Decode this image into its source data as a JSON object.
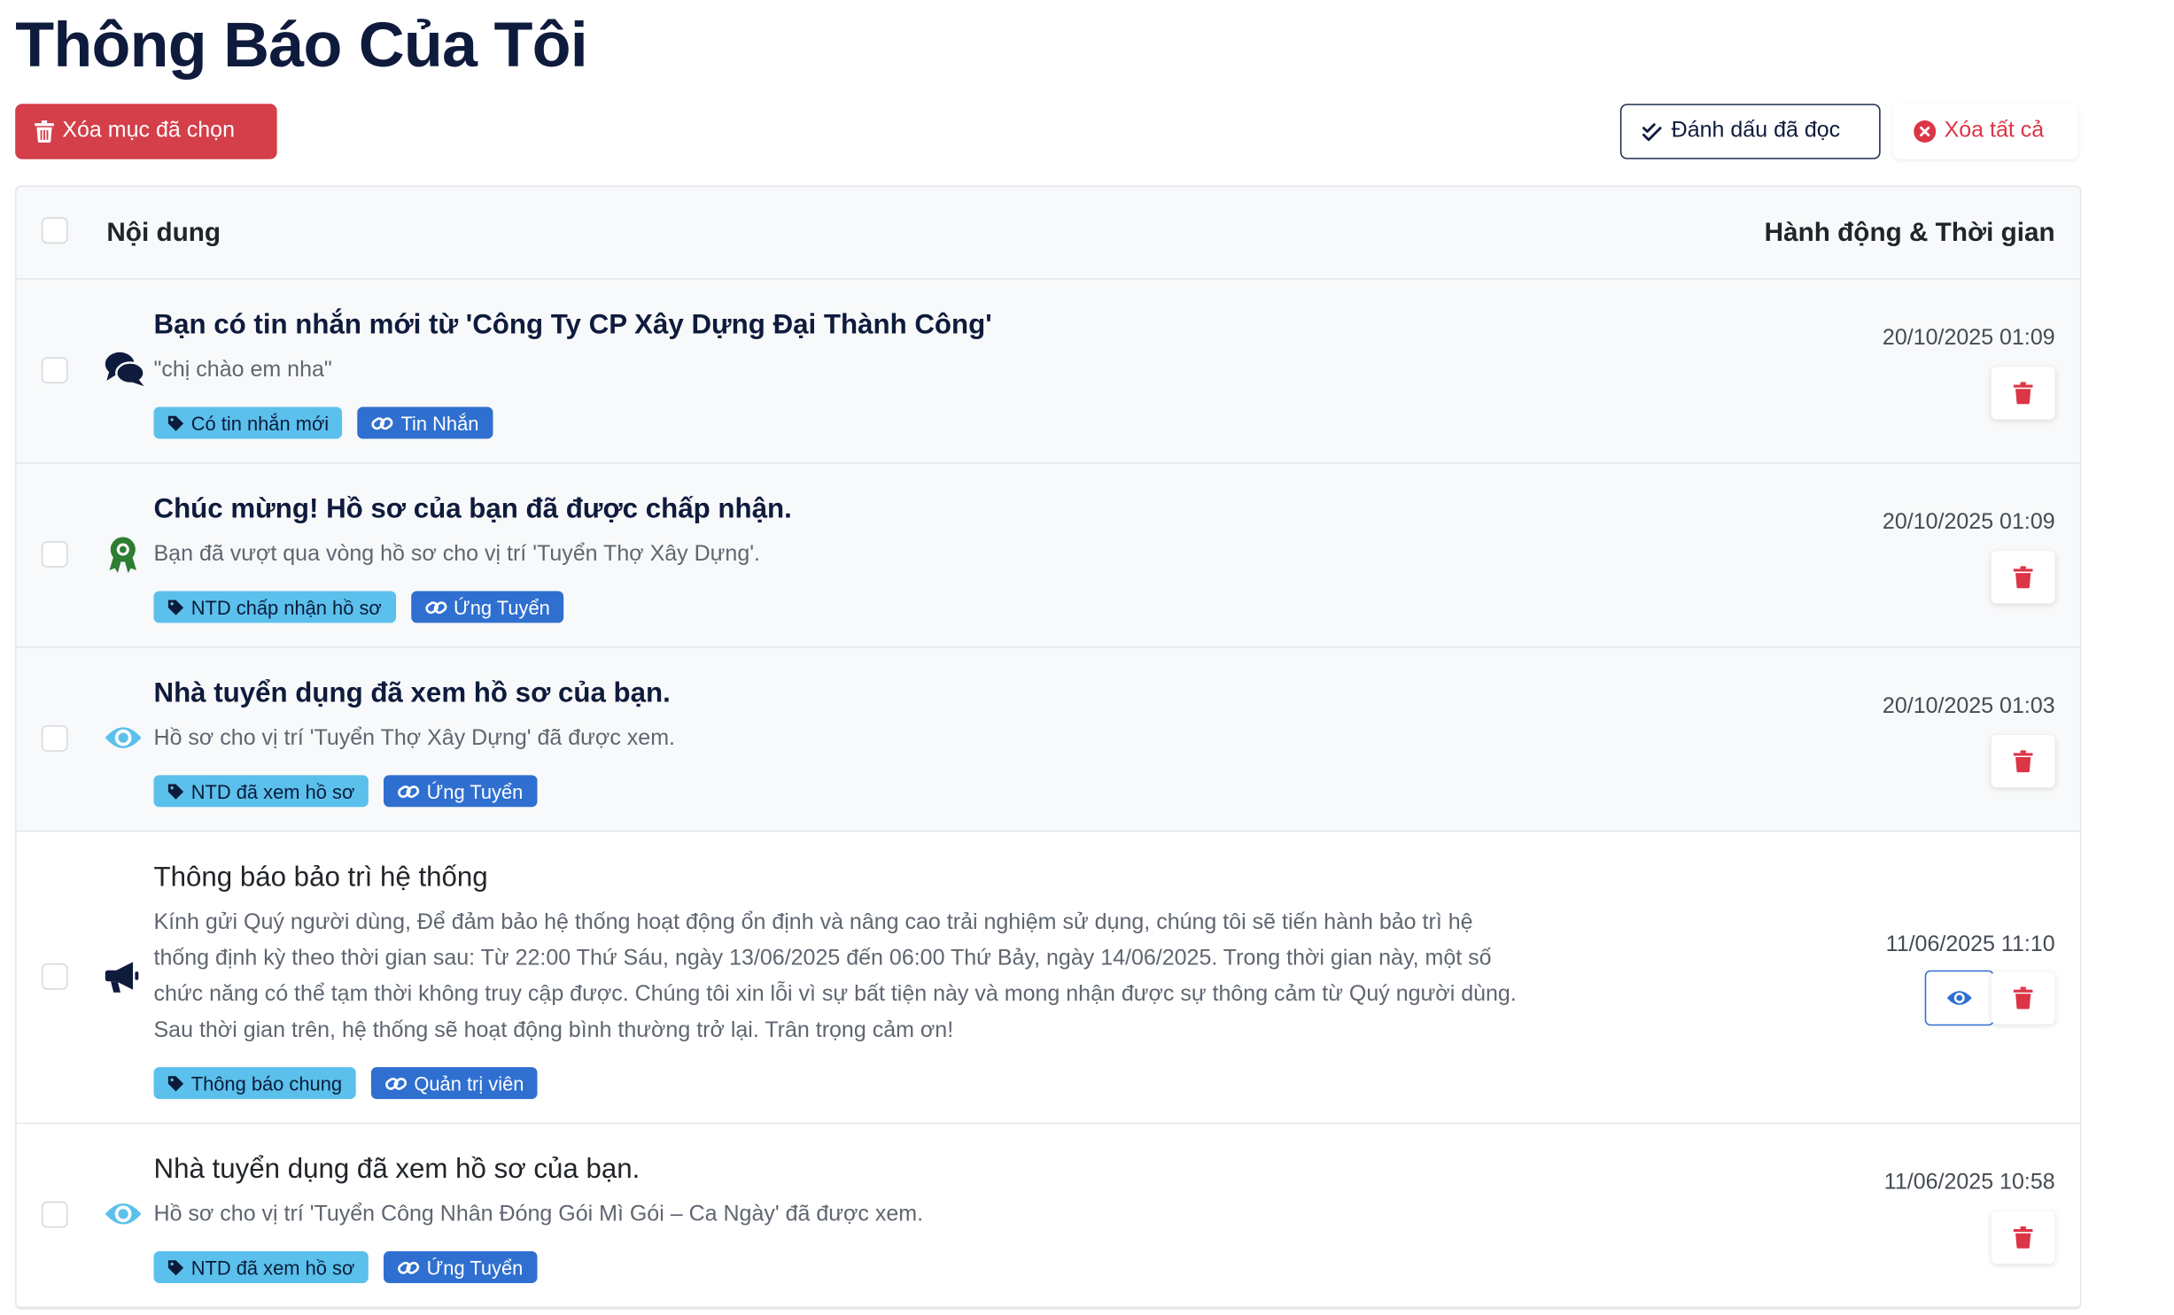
{
  "page": {
    "title": "Thông Báo Của Tôi"
  },
  "toolbar": {
    "delete_selected_label": "Xóa mục đã chọn",
    "mark_read_label": "Đánh dấu đã đọc",
    "delete_all_label": "Xóa tất cả"
  },
  "table": {
    "header_content": "Nội dung",
    "header_actions": "Hành động & Thời gian"
  },
  "colors": {
    "danger": "#dc3545",
    "primary": "#2f6fd0",
    "info": "#5bc0eb",
    "navy": "#0f1b3d",
    "success": "#2e7d32"
  },
  "notifications": [
    {
      "icon": "comments-icon",
      "title": "Bạn có tin nhắn mới từ 'Công Ty CP Xây Dựng Đại Thành Công'",
      "message": "\"chị chào em nha\"",
      "type_tag": "Có tin nhắn mới",
      "link_tag": "Tin Nhắn",
      "time": "20/10/2025 01:09",
      "read": false,
      "has_view": false
    },
    {
      "icon": "award-icon",
      "title": "Chúc mừng! Hồ sơ của bạn đã được chấp nhận.",
      "message": "Bạn đã vượt qua vòng hồ sơ cho vị trí 'Tuyển Thợ Xây Dựng'.",
      "type_tag": "NTD chấp nhận hồ sơ",
      "link_tag": "Ứng Tuyển",
      "time": "20/10/2025 01:09",
      "read": false,
      "has_view": false
    },
    {
      "icon": "eye-icon",
      "title": "Nhà tuyển dụng đã xem hồ sơ của bạn.",
      "message": "Hồ sơ cho vị trí 'Tuyển Thợ Xây Dựng' đã được xem.",
      "type_tag": "NTD đã xem hồ sơ",
      "link_tag": "Ứng Tuyển",
      "time": "20/10/2025 01:03",
      "read": false,
      "has_view": false
    },
    {
      "icon": "megaphone-icon",
      "title": "Thông báo bảo trì hệ thống",
      "message": "Kính gửi Quý người dùng, Để đảm bảo hệ thống hoạt động ổn định và nâng cao trải nghiệm sử dụng, chúng tôi sẽ tiến hành bảo trì hệ thống định kỳ theo thời gian sau: Từ 22:00 Thứ Sáu, ngày 13/06/2025 đến 06:00 Thứ Bảy, ngày 14/06/2025. Trong thời gian này, một số chức năng có thể tạm thời không truy cập được. Chúng tôi xin lỗi vì sự bất tiện này và mong nhận được sự thông cảm từ Quý người dùng. Sau thời gian trên, hệ thống sẽ hoạt động bình thường trở lại. Trân trọng cảm ơn!",
      "type_tag": "Thông báo chung",
      "link_tag": "Quản trị viên",
      "time": "11/06/2025 11:10",
      "read": true,
      "has_view": true
    },
    {
      "icon": "eye-icon",
      "title": "Nhà tuyển dụng đã xem hồ sơ của bạn.",
      "message": "Hồ sơ cho vị trí 'Tuyển Công Nhân Đóng Gói Mì Gói – Ca Ngày' đã được xem.",
      "type_tag": "NTD đã xem hồ sơ",
      "link_tag": "Ứng Tuyển",
      "time": "11/06/2025 10:58",
      "read": true,
      "has_view": false
    }
  ]
}
